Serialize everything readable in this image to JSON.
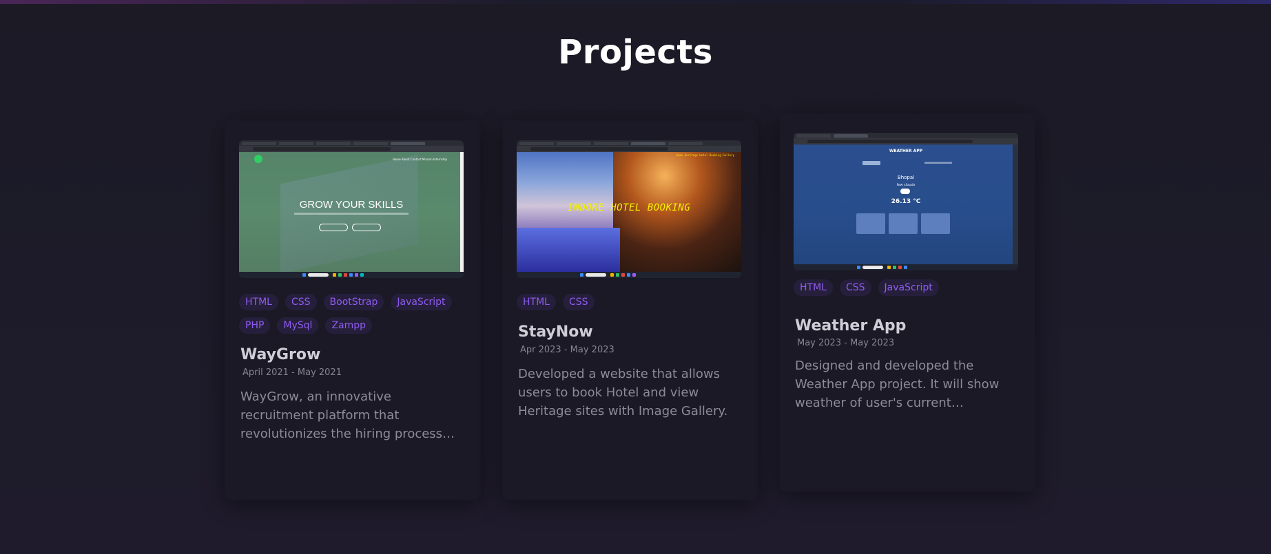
{
  "section": {
    "title": "Projects"
  },
  "projects": [
    {
      "screenshot": {
        "headline": "GROW YOUR SKILLS",
        "nav": "Home   About   Contact   Mission   Internship"
      },
      "tags": [
        "HTML",
        "CSS",
        "BootStrap",
        "JavaScript",
        "PHP",
        "MySql",
        "Zampp"
      ],
      "title": "WayGrow",
      "date": "April 2021 - May 2021",
      "description": "WayGrow, an innovative recruitment platform that revolutionizes the hiring process b..."
    },
    {
      "screenshot": {
        "headline": "INDORE HOTEL BOOKING",
        "nav": "Home   Heritage   Hotel Booking   Gallery"
      },
      "tags": [
        "HTML",
        "CSS"
      ],
      "title": "StayNow",
      "date": "Apr 2023 - May 2023",
      "description": "Developed a website that allows users to book Hotel and view Heritage sites with Image Gallery."
    },
    {
      "screenshot": {
        "app_title": "WEATHER APP",
        "city": "Bhopal",
        "condition": "few clouds",
        "temperature": "26.13 °C"
      },
      "tags": [
        "HTML",
        "CSS",
        "JavaScript"
      ],
      "title": "Weather App",
      "date": "May 2023 - May 2023",
      "description": "Designed and developed the Weather App project. It will show weather of user's current location..."
    }
  ],
  "colors": {
    "background": "#1c1a27",
    "card": "#1a1925",
    "tag_bg": "#261f3c",
    "tag_text": "#8e5cf0"
  }
}
